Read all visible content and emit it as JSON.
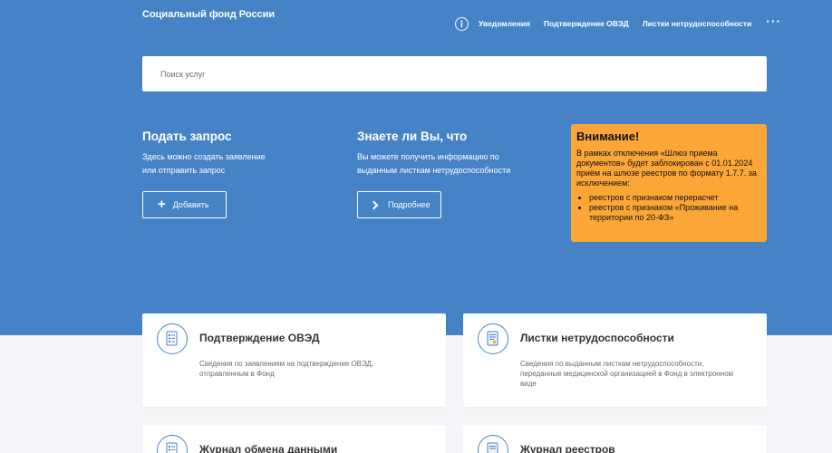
{
  "header": {
    "brand": "Социальный фонд России",
    "nav": [
      {
        "label": "Уведомления"
      },
      {
        "label": "Подтверждение ОВЭД"
      },
      {
        "label": "Листки нетрудоспособности"
      }
    ],
    "more": "···"
  },
  "search": {
    "placeholder": "Поиск услуг",
    "value": ""
  },
  "request": {
    "title": "Подать запрос",
    "text_line1": "Здесь можно создать заявление",
    "text_line2": "или отправить запрос",
    "button": "Добавить"
  },
  "info": {
    "title": "Знаете ли Вы, что",
    "text_line1": "Вы можете получить информацию по",
    "text_line2": "выданным листкам нетрудоспособности",
    "button": "Подробнее"
  },
  "notice": {
    "title": "Внимание!",
    "text": "В рамках отключения «Шлюз приема документов» будет заблокирован с 01.01.2024 приём на шлюзе реестров по формату 1.7.7. за исключением:",
    "items": [
      "реестров с признаком перерасчет",
      "реестров с признаком «Проживание на территории по 20-ФЗ»"
    ]
  },
  "cards": [
    {
      "title": "Подтверждение ОВЭД",
      "text": "Сведения по заявлениям на подтверждение ОВЭД, отправленным в Фонд"
    },
    {
      "title": "Листки нетрудоспособности",
      "text": "Сведения по выданным листкам нетрудоспособности, переданные медицинской организацией в Фонд в электронном виде"
    },
    {
      "title": "Журнал обмена данными",
      "text": ""
    },
    {
      "title": "Журнал реестров",
      "text": ""
    }
  ],
  "colors": {
    "primary": "#4583c6",
    "notice": "#fba637",
    "background": "#f4f6f9"
  }
}
